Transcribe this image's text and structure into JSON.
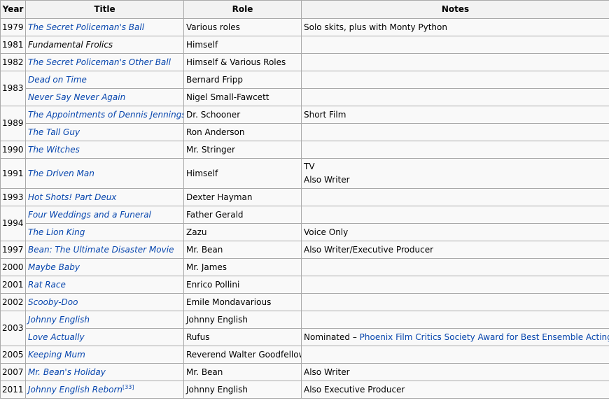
{
  "headers": {
    "year": "Year",
    "title": "Title",
    "role": "Role",
    "notes": "Notes"
  },
  "colors": {
    "link": "#0645ad",
    "border": "#aaaaaa",
    "header_bg": "#f2f2f2",
    "row_bg": "#f9f9f9"
  },
  "groups": [
    {
      "year": "1979",
      "films": [
        {
          "title": "The Secret Policeman's Ball",
          "link": true,
          "role": "Various roles",
          "notes": [
            "Solo skits, plus with Monty Python"
          ]
        }
      ]
    },
    {
      "year": "1981",
      "films": [
        {
          "title": "Fundamental Frolics",
          "link": false,
          "role": "Himself",
          "notes": []
        }
      ]
    },
    {
      "year": "1982",
      "films": [
        {
          "title": "The Secret Policeman's Other Ball",
          "link": true,
          "role": "Himself & Various Roles",
          "notes": []
        }
      ]
    },
    {
      "year": "1983",
      "films": [
        {
          "title": "Dead on Time",
          "link": true,
          "role": "Bernard Fripp",
          "notes": []
        },
        {
          "title": "Never Say Never Again",
          "link": true,
          "role": "Nigel Small-Fawcett",
          "notes": []
        }
      ]
    },
    {
      "year": "1989",
      "films": [
        {
          "title": "The Appointments of Dennis Jennings",
          "link": true,
          "role": "Dr. Schooner",
          "notes": [
            "Short Film"
          ]
        },
        {
          "title": "The Tall Guy",
          "link": true,
          "role": "Ron Anderson",
          "notes": []
        }
      ]
    },
    {
      "year": "1990",
      "films": [
        {
          "title": "The Witches",
          "link": true,
          "role": "Mr. Stringer",
          "notes": []
        }
      ]
    },
    {
      "year": "1991",
      "films": [
        {
          "title": "The Driven Man",
          "link": true,
          "role": "Himself",
          "notes": [
            "TV",
            "Also Writer"
          ]
        }
      ]
    },
    {
      "year": "1993",
      "films": [
        {
          "title": "Hot Shots! Part Deux",
          "link": true,
          "role": "Dexter Hayman",
          "notes": []
        }
      ]
    },
    {
      "year": "1994",
      "films": [
        {
          "title": "Four Weddings and a Funeral",
          "link": true,
          "role": "Father Gerald",
          "notes": []
        },
        {
          "title": "The Lion King",
          "link": true,
          "role": "Zazu",
          "notes": [
            "Voice Only"
          ]
        }
      ]
    },
    {
      "year": "1997",
      "films": [
        {
          "title": "Bean: The Ultimate Disaster Movie",
          "link": true,
          "role": "Mr. Bean",
          "notes": [
            "Also Writer/Executive Producer"
          ]
        }
      ]
    },
    {
      "year": "2000",
      "films": [
        {
          "title": "Maybe Baby",
          "link": true,
          "role": "Mr. James",
          "notes": []
        }
      ]
    },
    {
      "year": "2001",
      "films": [
        {
          "title": "Rat Race",
          "link": true,
          "role": "Enrico Pollini",
          "notes": []
        }
      ]
    },
    {
      "year": "2002",
      "films": [
        {
          "title": "Scooby-Doo",
          "link": true,
          "role": "Emile Mondavarious",
          "notes": []
        }
      ]
    },
    {
      "year": "2003",
      "films": [
        {
          "title": "Johnny English",
          "link": true,
          "role": "Johnny English",
          "notes": []
        },
        {
          "title": "Love Actually",
          "link": true,
          "role": "Rufus",
          "notes": [],
          "note_prefix": "Nominated – ",
          "note_link": "Phoenix Film Critics Society Award for Best Ensemble Acting"
        }
      ]
    },
    {
      "year": "2005",
      "films": [
        {
          "title": "Keeping Mum",
          "link": true,
          "role": "Reverend Walter Goodfellow",
          "notes": []
        }
      ]
    },
    {
      "year": "2007",
      "films": [
        {
          "title": "Mr. Bean's Holiday",
          "link": true,
          "role": "Mr. Bean",
          "notes": [
            "Also Writer"
          ]
        }
      ]
    },
    {
      "year": "2011",
      "films": [
        {
          "title": "Johnny English Reborn",
          "link": true,
          "ref": "[33]",
          "role": "Johnny English",
          "notes": [
            "Also Executive Producer"
          ]
        }
      ]
    }
  ]
}
